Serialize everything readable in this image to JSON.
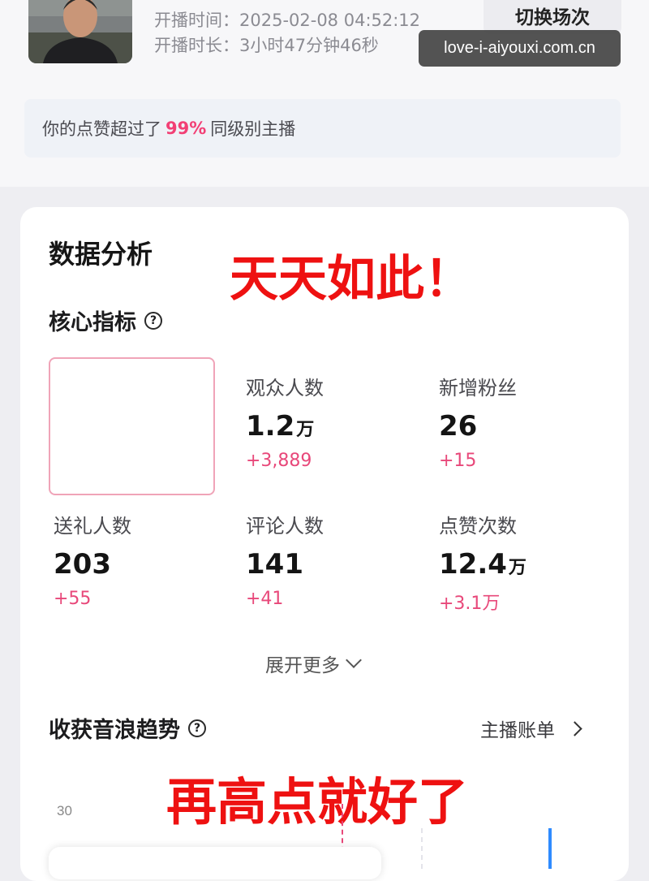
{
  "header": {
    "start_time": "开播时间：2025-02-08 04:52:12",
    "duration": "开播时长：3小时47分钟46秒",
    "switch_session_label": "切换场次",
    "watermark": "love-i-aiyouxi.com.cn"
  },
  "like_banner": {
    "prefix": "你的点赞超过了",
    "percent": "99%",
    "suffix": "同级别主播"
  },
  "analysis": {
    "title": "数据分析",
    "annotation_top": "天天如此！",
    "annotation_bottom": "再高点就好了",
    "core_metrics_title": "核心指标",
    "help_glyph": "?",
    "metrics": {
      "audience": {
        "label": "观众人数",
        "value": "1.2",
        "unit": "万",
        "delta": "+3,889"
      },
      "new_fans": {
        "label": "新增粉丝",
        "value": "26",
        "unit": "",
        "delta": "+15"
      },
      "gift_senders": {
        "label": "送礼人数",
        "value": "203",
        "unit": "",
        "delta": "+55"
      },
      "commenters": {
        "label": "评论人数",
        "value": "141",
        "unit": "",
        "delta": "+41"
      },
      "likes": {
        "label": "点赞次数",
        "value": "12.4",
        "unit": "万",
        "delta": "+3.1万"
      }
    },
    "expand_more": "展开更多",
    "trend_title": "收获音浪趋势",
    "host_bill": "主播账单",
    "y_tick": "30"
  },
  "colors": {
    "accent_pink": "#e8487a",
    "annotation_red": "#ee1111",
    "chart_blue": "#2f8bff"
  }
}
